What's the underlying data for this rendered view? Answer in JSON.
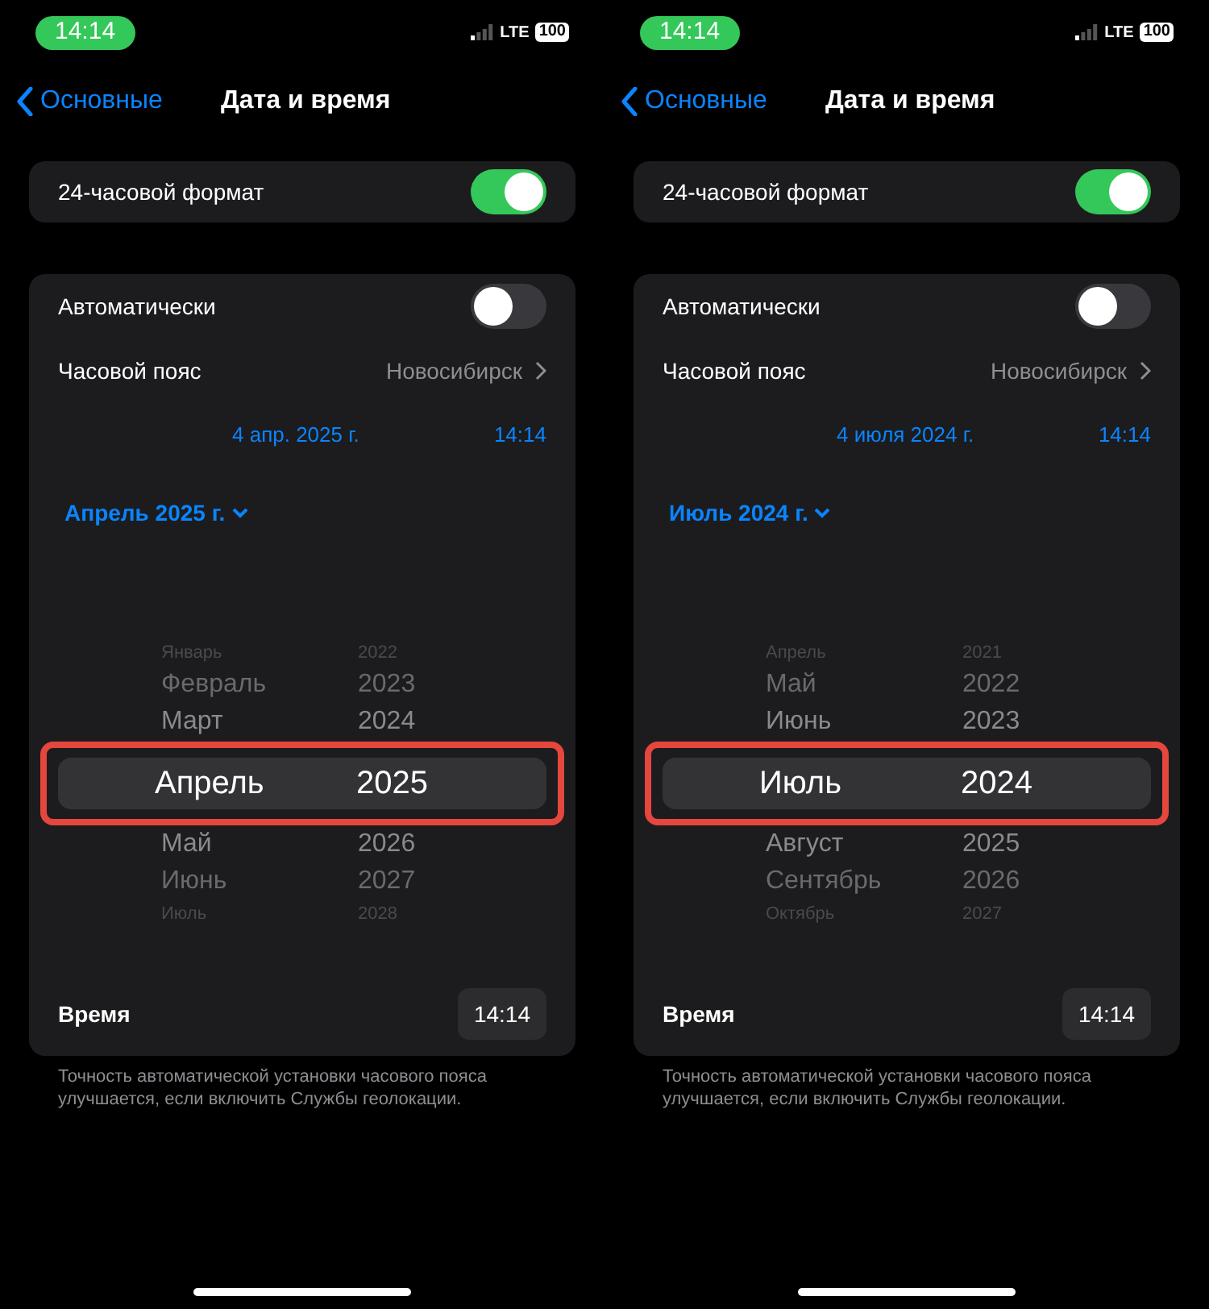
{
  "screens": [
    {
      "status": {
        "time": "14:14",
        "network": "LTE",
        "battery": "100"
      },
      "nav": {
        "back": "Основные",
        "title": "Дата и время"
      },
      "format_row": {
        "label": "24-часовой формат",
        "on": true
      },
      "auto_row": {
        "label": "Автоматически",
        "on": false
      },
      "timezone": {
        "label": "Часовой пояс",
        "value": "Новосибирск"
      },
      "date": "4 апр. 2025 г.",
      "time": "14:14",
      "month_button": "Апрель 2025 г.",
      "picker": {
        "highlighted": true,
        "months": [
          {
            "label": "Январь",
            "selected": false
          },
          {
            "label": "Февраль",
            "selected": false
          },
          {
            "label": "Март",
            "selected": false
          },
          {
            "label": "Апрель",
            "selected": true
          },
          {
            "label": "Май",
            "selected": false
          },
          {
            "label": "Июнь",
            "selected": false
          },
          {
            "label": "Июль",
            "selected": false
          }
        ],
        "years": [
          {
            "label": "2022",
            "selected": false
          },
          {
            "label": "2023",
            "selected": false
          },
          {
            "label": "2024",
            "selected": false
          },
          {
            "label": "2025",
            "selected": true
          },
          {
            "label": "2026",
            "selected": false
          },
          {
            "label": "2027",
            "selected": false
          },
          {
            "label": "2028",
            "selected": false
          }
        ]
      },
      "time_row": {
        "label": "Время",
        "value": "14:14"
      },
      "footnote": "Точность автоматической установки часового пояса улучшается, если включить Службы геолокации."
    },
    {
      "status": {
        "time": "14:14",
        "network": "LTE",
        "battery": "100"
      },
      "nav": {
        "back": "Основные",
        "title": "Дата и время"
      },
      "format_row": {
        "label": "24-часовой формат",
        "on": true
      },
      "auto_row": {
        "label": "Автоматически",
        "on": false
      },
      "timezone": {
        "label": "Часовой пояс",
        "value": "Новосибирск"
      },
      "date": "4 июля 2024 г.",
      "time": "14:14",
      "month_button": "Июль 2024 г.",
      "picker": {
        "highlighted": true,
        "months": [
          {
            "label": "Апрель",
            "selected": false
          },
          {
            "label": "Май",
            "selected": false
          },
          {
            "label": "Июнь",
            "selected": false
          },
          {
            "label": "Июль",
            "selected": true
          },
          {
            "label": "Август",
            "selected": false
          },
          {
            "label": "Сентябрь",
            "selected": false
          },
          {
            "label": "Октябрь",
            "selected": false
          }
        ],
        "years": [
          {
            "label": "2021",
            "selected": false
          },
          {
            "label": "2022",
            "selected": false
          },
          {
            "label": "2023",
            "selected": false
          },
          {
            "label": "2024",
            "selected": true
          },
          {
            "label": "2025",
            "selected": false
          },
          {
            "label": "2026",
            "selected": false
          },
          {
            "label": "2027",
            "selected": false
          }
        ]
      },
      "time_row": {
        "label": "Время",
        "value": "14:14"
      },
      "footnote": "Точность автоматической установки часового пояса улучшается, если включить Службы геолокации."
    }
  ]
}
